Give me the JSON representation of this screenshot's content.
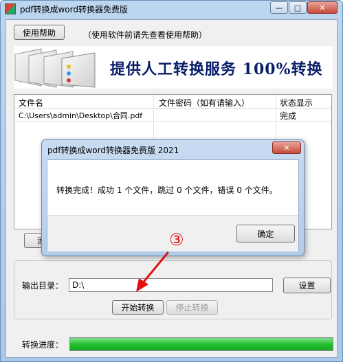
{
  "window": {
    "title": "pdf转换成word转换器免费版",
    "minimize": "—",
    "maximize": "□",
    "close": "✕"
  },
  "toolbar": {
    "help_button": "使用帮助",
    "hint": "（使用软件前请先查看使用帮助）"
  },
  "banner": {
    "text": "提供人工转换服务 100%转换"
  },
  "table": {
    "headers": [
      "文件名",
      "文件密码（如有请输入）",
      "状态显示"
    ],
    "rows": [
      {
        "file": "C:\\Users\\admin\\Desktop\\合同.pdf",
        "password": "",
        "status": "完成"
      }
    ]
  },
  "behind_button": {
    "label": "添"
  },
  "output": {
    "label": "输出目录：",
    "value": "D:\\",
    "settings_button": "设置"
  },
  "actions": {
    "start": "开始转换",
    "stop": "停止转换"
  },
  "progress": {
    "label": "转换进度：",
    "value": 1.0
  },
  "dialog": {
    "title": "pdf转换成word转换器免费版 2021",
    "close": "✕",
    "message": "转换完成！成功 1 个文件，跳过 0 个文件，错误 0 个文件。",
    "ok": "确定"
  },
  "annotation": {
    "number": "③",
    "color": "#e01010"
  }
}
